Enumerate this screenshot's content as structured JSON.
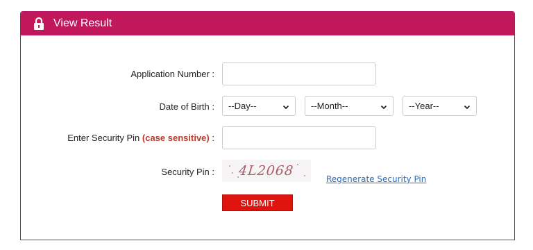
{
  "header": {
    "title": "View Result",
    "icon": "lock-icon",
    "bg_color": "#c0185a"
  },
  "form": {
    "application_number": {
      "label": "Application Number :",
      "value": ""
    },
    "date_of_birth": {
      "label": "Date of Birth :",
      "day": "--Day--",
      "month": "--Month--",
      "year": "--Year--"
    },
    "security_pin_input": {
      "label_main": "Enter Security Pin",
      "label_highlight": "(case sensitive)",
      "label_colon": ":",
      "value": ""
    },
    "security_pin": {
      "label": "Security Pin :",
      "captcha_text": "4L2068",
      "regenerate_label": "Regenerate Security Pin"
    },
    "submit_label": "SUBMIT"
  }
}
